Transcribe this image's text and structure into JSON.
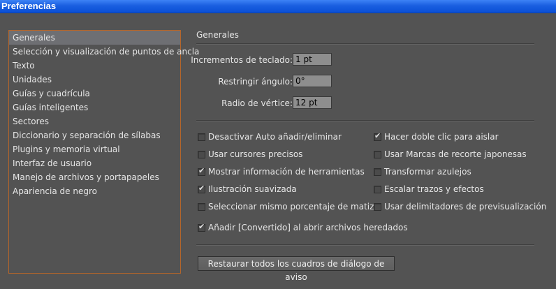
{
  "window": {
    "title": "Preferencias"
  },
  "sidebar": {
    "items": [
      {
        "label": "Generales",
        "selected": true
      },
      {
        "label": "Selección y visualización de puntos de ancla"
      },
      {
        "label": "Texto"
      },
      {
        "label": "Unidades"
      },
      {
        "label": "Guías y cuadrícula"
      },
      {
        "label": "Guías inteligentes"
      },
      {
        "label": "Sectores"
      },
      {
        "label": "Diccionario y separación de sílabas"
      },
      {
        "label": "Plugins y memoria virtual"
      },
      {
        "label": "Interfaz de usuario"
      },
      {
        "label": "Manejo de archivos y portapapeles"
      },
      {
        "label": "Apariencia de negro"
      }
    ]
  },
  "main": {
    "section_title": "Generales",
    "fields": {
      "keyboard_increment": {
        "label": "Incrementos de teclado:",
        "value": "1 pt"
      },
      "constrain_angle": {
        "label": "Restringir ángulo:",
        "value": "0°"
      },
      "corner_radius": {
        "label": "Radio de vértice:",
        "value": "12 pt"
      }
    },
    "checkboxes_left": [
      {
        "label": "Desactivar Auto añadir/eliminar",
        "checked": false
      },
      {
        "label": "Usar cursores precisos",
        "checked": false
      },
      {
        "label": "Mostrar información de herramientas",
        "checked": true
      },
      {
        "label": "Ilustración suavizada",
        "checked": true
      },
      {
        "label": "Seleccionar mismo porcentaje de matiz",
        "checked": false
      },
      {
        "label": "Añadir [Convertido] al abrir archivos heredados",
        "checked": true
      }
    ],
    "checkboxes_right": [
      {
        "label": "Hacer doble clic para aislar",
        "checked": true
      },
      {
        "label": "Usar Marcas de recorte japonesas",
        "checked": false
      },
      {
        "label": "Transformar azulejos",
        "checked": false
      },
      {
        "label": "Escalar trazos y efectos",
        "checked": false
      },
      {
        "label": "Usar delimitadores de previsualización",
        "checked": false
      }
    ],
    "restore_button": "Restaurar todos los cuadros de diálogo de aviso"
  },
  "colors": {
    "title_bar": "#1a5fe0",
    "panel_bg": "#535353",
    "sidebar_border": "#b5652a",
    "selected_item": "#6e6f73"
  }
}
